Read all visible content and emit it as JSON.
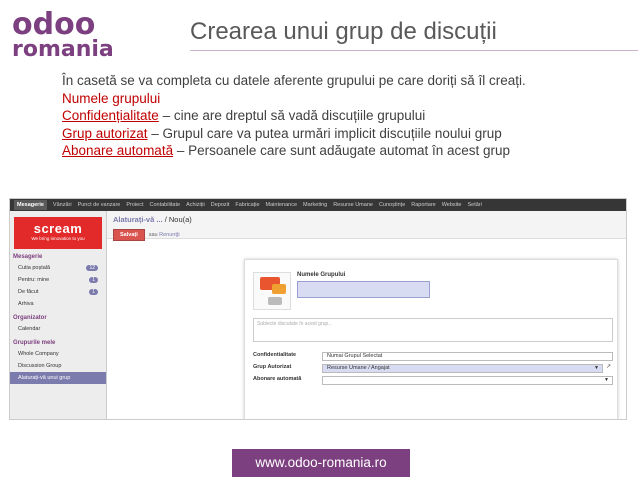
{
  "logo": {
    "line1": "odoo",
    "line2": "romania"
  },
  "title": "Crearea unui grup de discuții",
  "intro": {
    "line1": "În casetă se va completa cu datele aferente grupului pe care doriți să îl creați.",
    "item1_term": "Numele grupului",
    "item2_term": "Confidențialitate",
    "item2_desc": " – cine are dreptul să vadă discuțiile grupului",
    "item3_term": "Grup autorizat",
    "item3_desc": " – Grupul care va putea urmări implicit discuțiile noului grup",
    "item4_term": "Abonare automată",
    "item4_desc": " – Persoanele care sunt adăugate automat în acest grup"
  },
  "topbar": {
    "items": [
      "Mesagerie",
      "Vânzări",
      "Punct de vanzare",
      "Proiect",
      "Contabilitate",
      "Achiziții",
      "Depozit",
      "Fabricație",
      "Maintenance",
      "Marketing",
      "Resurse Umane",
      "Cunoștințe",
      "Raportare",
      "Website",
      "Setări"
    ]
  },
  "sidebar": {
    "brand": {
      "name": "scream",
      "tagline": "We bring innovation to you"
    },
    "sections": [
      {
        "title": "Mesagerie",
        "items": [
          {
            "label": "Cutia poștală",
            "badge": "12"
          },
          {
            "label": "Pentru: mine",
            "badge": "1"
          },
          {
            "label": "De făcut",
            "badge": "1"
          },
          {
            "label": "Arhiva",
            "badge": ""
          }
        ]
      },
      {
        "title": "Organizator",
        "items": [
          {
            "label": "Calendar",
            "badge": ""
          }
        ]
      },
      {
        "title": "Grupurile mele",
        "items": [
          {
            "label": "Whole Company",
            "badge": ""
          },
          {
            "label": "Discussion Group",
            "badge": ""
          },
          {
            "label": "Alaturați-vă unui grup",
            "badge": ""
          }
        ]
      }
    ]
  },
  "main": {
    "breadcrumb": "Alaturați-vă ...",
    "breadcrumb_current": "/ Nou(a)",
    "save_label": "Salvați",
    "or_label": "sau",
    "discard_label": "Renunțți"
  },
  "form": {
    "name_label": "Numele Grupului",
    "desc_placeholder": "Subiecte discutate în acest grup...",
    "confidentiality_label": "Confidentialitate",
    "confidentiality_value": "Numai Grupul Selectat",
    "group_label": "Grup Autorizat",
    "group_value": "Resurse Umane / Angajat",
    "subscribe_label": "Abonare automată",
    "subscribe_value": ""
  },
  "footer": "www.odoo-romania.ro"
}
